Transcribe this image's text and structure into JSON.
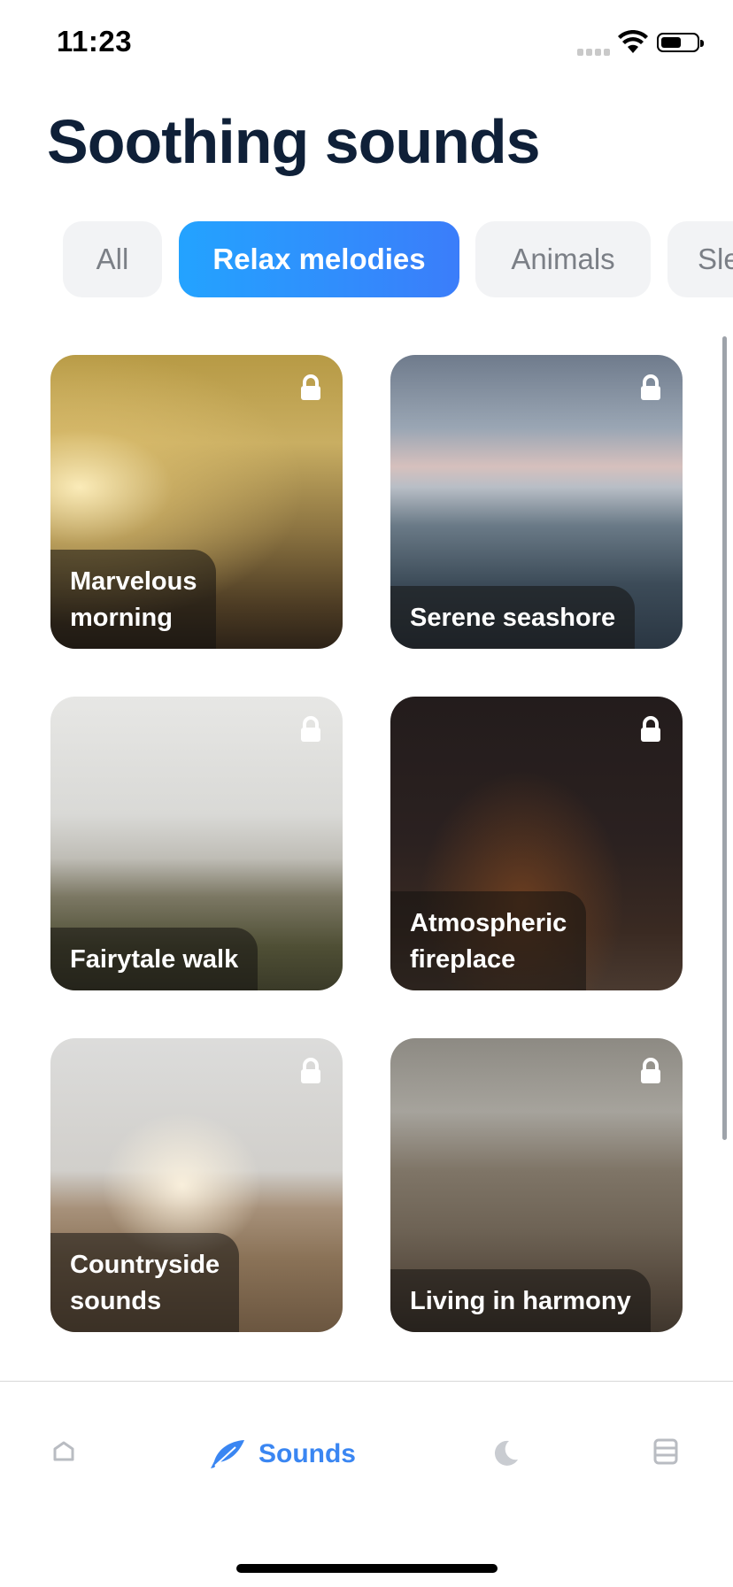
{
  "status": {
    "time": "11:23"
  },
  "title": "Soothing sounds",
  "tabs": [
    {
      "label": "All",
      "active": false
    },
    {
      "label": "Relax melodies",
      "active": true
    },
    {
      "label": "Animals",
      "active": false
    },
    {
      "label": "Sleep",
      "active": false
    }
  ],
  "cards": [
    {
      "title": "Marvelous\nmorning",
      "locked": true
    },
    {
      "title": "Serene seashore",
      "locked": true
    },
    {
      "title": "Fairytale walk",
      "locked": true
    },
    {
      "title": "Atmospheric\nfireplace",
      "locked": true
    },
    {
      "title": "Countryside\nsounds",
      "locked": true
    },
    {
      "title": "Living in harmony",
      "locked": true
    }
  ],
  "tabbar": {
    "items": [
      {
        "icon": "home-icon",
        "label": ""
      },
      {
        "icon": "feather-icon",
        "label": "Sounds",
        "active": true
      },
      {
        "icon": "moon-icon",
        "label": ""
      },
      {
        "icon": "journal-icon",
        "label": ""
      }
    ]
  },
  "colors": {
    "accent": "#3a86f2",
    "title": "#0f2038",
    "tab_bg": "#f2f3f5"
  }
}
